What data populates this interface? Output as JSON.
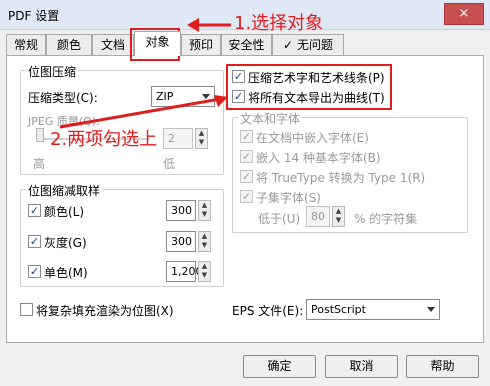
{
  "window": {
    "title": "PDF 设置",
    "close_icon": "×"
  },
  "tabs": [
    {
      "label": "常规"
    },
    {
      "label": "颜色"
    },
    {
      "label": "文档"
    },
    {
      "label": "对象"
    },
    {
      "label": "预印"
    },
    {
      "label": "安全性"
    },
    {
      "label": "无问题"
    }
  ],
  "bitmap_compress": {
    "title": "位图压缩",
    "type_label": "压缩类型(C):",
    "type_value": "ZIP",
    "jpeg_quality_label": "JPEG 质量(Q):",
    "jpeg_value": "2",
    "high_label": "高",
    "low_label": "低"
  },
  "bitmap_downsample": {
    "title": "位图缩减取样",
    "items": [
      {
        "label": "颜色(L)",
        "value": "300",
        "checked": true
      },
      {
        "label": "灰度(G)",
        "value": "300",
        "checked": true
      },
      {
        "label": "单色(M)",
        "value": "1,200",
        "checked": true
      }
    ]
  },
  "options": {
    "compress_art": "压缩艺术字和艺术线条(P)",
    "export_text_as_curves": "将所有文本导出为曲线(T)"
  },
  "text_fonts": {
    "title": "文本和字体",
    "embed": "在文档中嵌入字体(E)",
    "embed14": "嵌入 14 种基本字体(B)",
    "truetype": "将 TrueType 转换为 Type 1(R)",
    "subset": "子集字体(S)",
    "below_label": "低于(U)",
    "below_value": "80",
    "percent_label": "% 的字符集"
  },
  "render_complex": "将复杂填充渲染为位图(X)",
  "eps": {
    "label": "EPS 文件(E):",
    "value": "PostScript"
  },
  "buttons": {
    "ok": "确定",
    "cancel": "取消",
    "help": "帮助"
  },
  "annotations": {
    "step1": "1.选择对象",
    "step2": "2.两项勾选上"
  },
  "colors": {
    "annotation_red": "#e11d1d"
  }
}
